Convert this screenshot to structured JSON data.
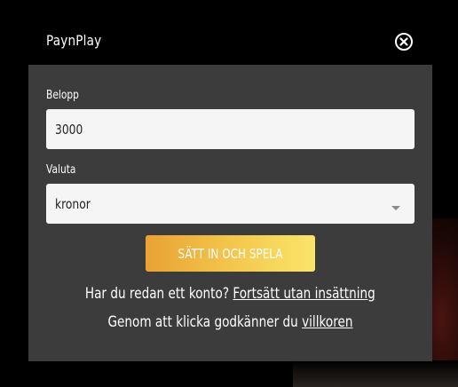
{
  "header": {
    "brand": "PaynPlay",
    "close_icon": "close-circle-icon"
  },
  "form": {
    "amount": {
      "label": "Belopp",
      "value": "3000"
    },
    "currency": {
      "label": "Valuta",
      "value": "kronor",
      "dropdown_icon": "caret-down-icon"
    },
    "submit_label": "SÄTT IN OCH SPELA",
    "submit_colors": [
      "#e9a233",
      "#fbe46a"
    ]
  },
  "footer": {
    "account_prompt": "Har du redan ett konto?",
    "account_link": "Fortsätt utan insättning",
    "terms_prompt": "Genom att klicka godkänner du",
    "terms_link": "villkoren"
  },
  "colors": {
    "page_bg": "#000000",
    "modal_bg": "#3c3c3c",
    "input_bg": "#f5f5f5"
  }
}
